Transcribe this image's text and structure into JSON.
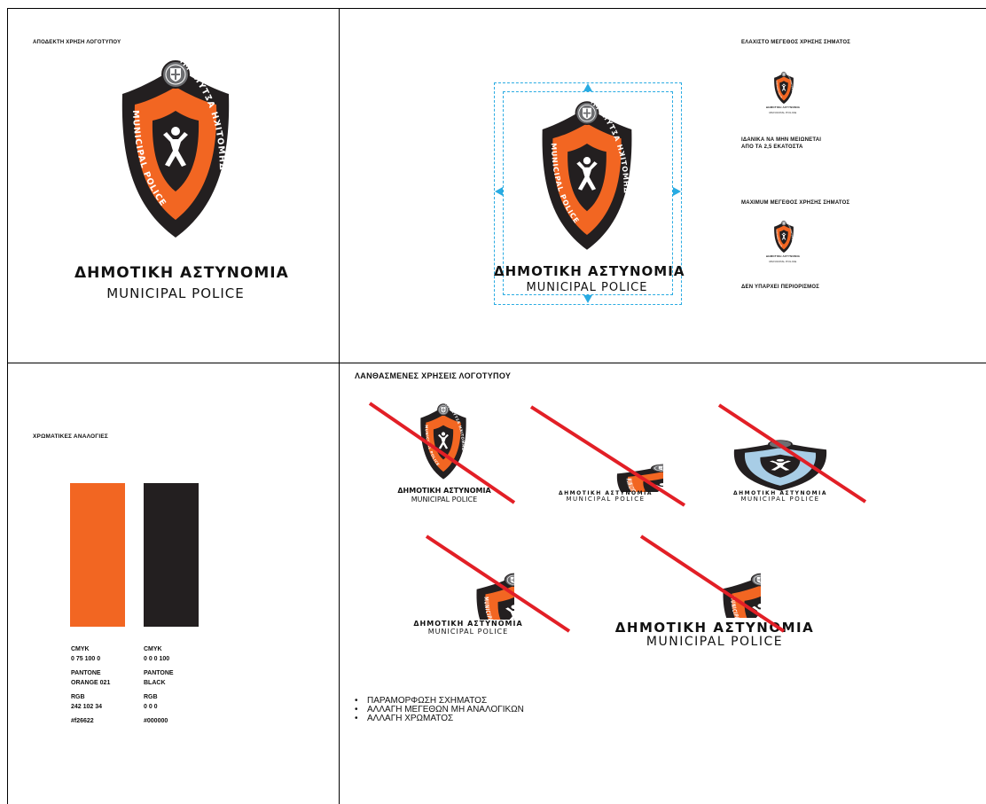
{
  "colors": {
    "orange": "#f26622",
    "black": "#231f20",
    "light_blue": "#a8cde6",
    "cross_red": "#e21f26",
    "guide_blue": "#29abe2"
  },
  "badge": {
    "ring_upper_right": "ΔΗΜΟΤΙΚΗ ΑΣΤΥΝΟΜΙΑ",
    "ring_left": "MUNICIPAL POLICE",
    "emblem_icon": "greek-coat-of-arms-icon",
    "center_icon": "person-figure-icon"
  },
  "panel_logo": {
    "caption": "ΑΠΟΔΕΚΤΗ ΧΡΗΣΗ ΛΟΓΟΤΥΠΟΥ",
    "wordmark_title": "ΔΗΜΟΤΙΚΗ ΑΣΤΥΝΟΜΙΑ",
    "wordmark_subtitle": "MUNICIPAL POLICE"
  },
  "panel_sizes": {
    "wordmark_title": "ΔΗΜΟΤΙΚΗ ΑΣΤΥΝΟΜΙΑ",
    "wordmark_subtitle": "MUNICIPAL POLICE",
    "min_caption": "ΕΛΑΧΙΣΤΟ ΜΕΓΕΘΟΣ ΧΡΗΣΗΣ ΣΗΜΑΤΟΣ",
    "min_note_line1": "ΙΔΑΝΙΚΑ ΝΑ ΜΗΝ ΜΕΙΩΝΕΤΑΙ",
    "min_note_line2": "ΑΠΟ ΤΑ 2,5 ΕΚΑΤΟΣΤΑ",
    "max_caption": "MAXIMUM ΜΕΓΕΘΟΣ ΧΡΗΣΗΣ ΣΗΜΑΤΟΣ",
    "max_note": "ΔΕΝ ΥΠΑΡΧΕΙ ΠΕΡΙΟΡΙΣΜΟΣ",
    "mini_title": "ΔΗΜΟΤΙΚΗ ΑΣΤΥΝΟΜΙΑ",
    "mini_subtitle": "MUNICIPAL POLICE"
  },
  "panel_colors": {
    "caption": "ΧΡΩΜΑΤΙΚΕΣ ΑΝΑΛΟΓΙΕΣ",
    "swatches": [
      {
        "cmyk_label": "CMYK",
        "cmyk": "0 75 100 0",
        "pantone_label": "PANTONE",
        "pantone": "ORANGE 021",
        "rgb_label": "RGB",
        "rgb": "242 102 34",
        "hex": "#f26622"
      },
      {
        "cmyk_label": "CMYK",
        "cmyk": "0 0 0 100",
        "pantone_label": "PANTONE",
        "pantone": "BLACK",
        "rgb_label": "RGB",
        "rgb": "0 0 0",
        "hex": "#000000"
      }
    ]
  },
  "panel_misuse": {
    "caption": "ΛΑΝΘΑΣΜΕΝΕΣ ΧΡΗΣΕΙΣ ΛΟΓΟΤΥΠΟΥ",
    "wordmark_title": "ΔΗΜΟΤΙΚΗ ΑΣΤΥΝΟΜΙΑ",
    "wordmark_subtitle": "MUNICIPAL POLICE",
    "bullets": [
      "ΠΑΡΑΜΟΡΦΩΣΗ ΣΧΗΜΑΤΟΣ",
      "ΑΛΛΑΓΗ ΜΕΓΕΘΩΝ ΜΗ ΑΝΑΛΟΓΙΚΩΝ",
      "ΑΛΛΑΓΗ ΧΡΩΜΑΤΟΣ"
    ]
  }
}
